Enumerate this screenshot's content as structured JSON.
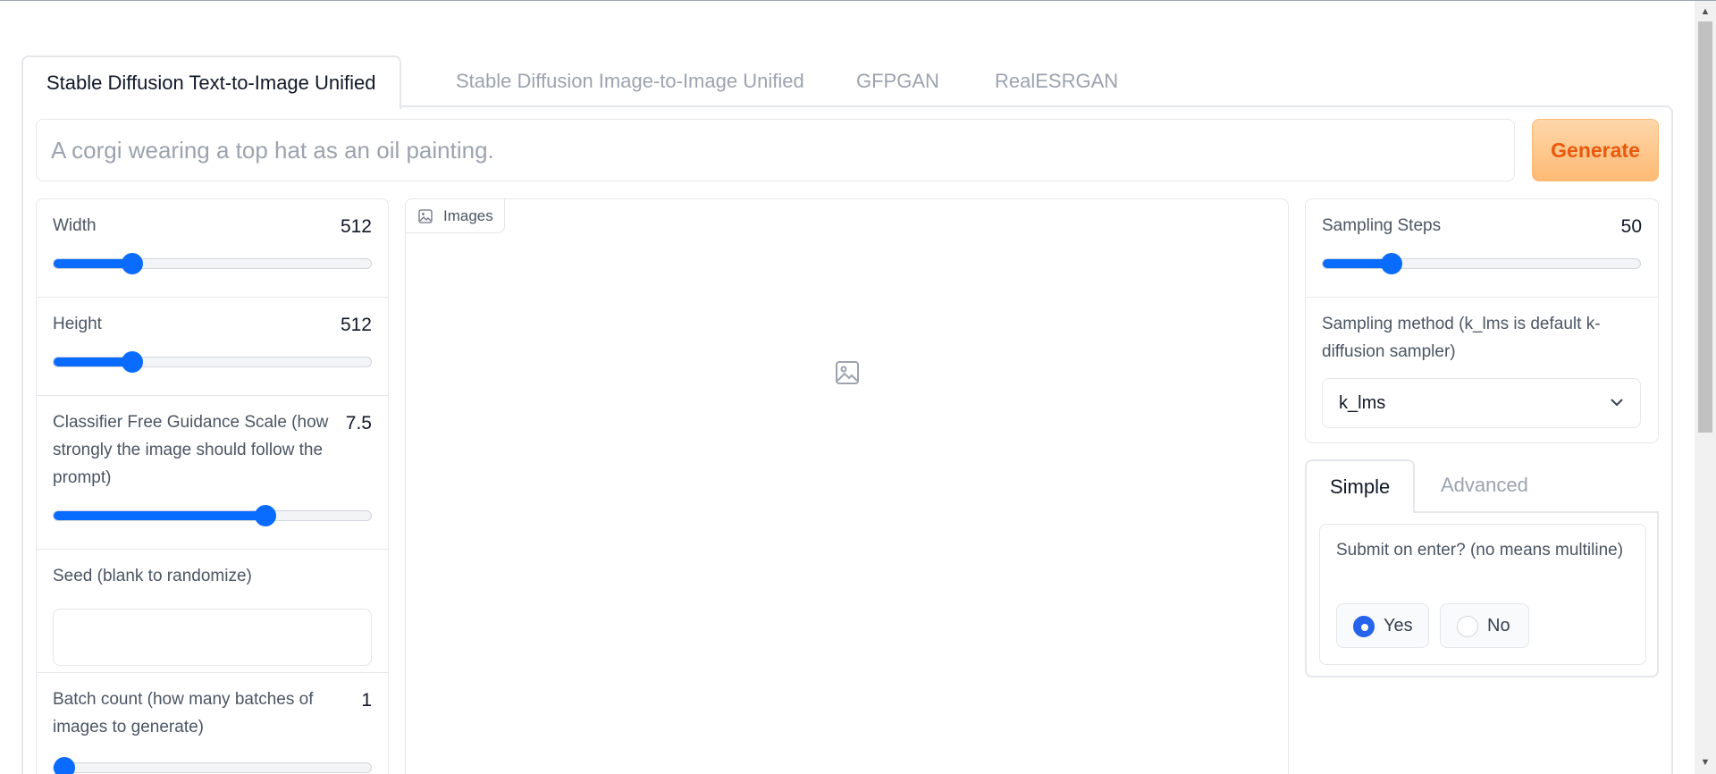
{
  "tabs": [
    {
      "label": "Stable Diffusion Text-to-Image Unified",
      "active": true
    },
    {
      "label": "Stable Diffusion Image-to-Image Unified",
      "active": false
    },
    {
      "label": "GFPGAN",
      "active": false
    },
    {
      "label": "RealESRGAN",
      "active": false
    }
  ],
  "prompt": {
    "placeholder": "A corgi wearing a top hat as an oil painting.",
    "value": ""
  },
  "generate_label": "Generate",
  "left": {
    "width": {
      "label": "Width",
      "value": "512",
      "level": 0.25
    },
    "height": {
      "label": "Height",
      "value": "512",
      "level": 0.25
    },
    "cfg": {
      "label": "Classifier Free Guidance Scale (how strongly the image should follow the prompt)",
      "value": "7.5",
      "level": 0.67
    },
    "seed": {
      "label": "Seed (blank to randomize)",
      "value": ""
    },
    "batch_count": {
      "label": "Batch count (how many batches of images to generate)",
      "value": "1",
      "level": 0.0
    }
  },
  "images": {
    "label": "Images"
  },
  "right": {
    "steps": {
      "label": "Sampling Steps",
      "value": "50",
      "level": 0.22
    },
    "sampler": {
      "label": "Sampling method (k_lms is default k-diffusion sampler)",
      "selected": "k_lms"
    }
  },
  "subtabs": [
    {
      "label": "Simple",
      "active": true
    },
    {
      "label": "Advanced",
      "active": false
    }
  ],
  "submit_on_enter": {
    "label": "Submit on enter? (no means multiline)",
    "options": [
      {
        "label": "Yes",
        "selected": true
      },
      {
        "label": "No",
        "selected": false
      }
    ]
  },
  "colors": {
    "accent": "#0a6cff",
    "generate_text": "#ea580c",
    "radio": "#2563eb"
  }
}
